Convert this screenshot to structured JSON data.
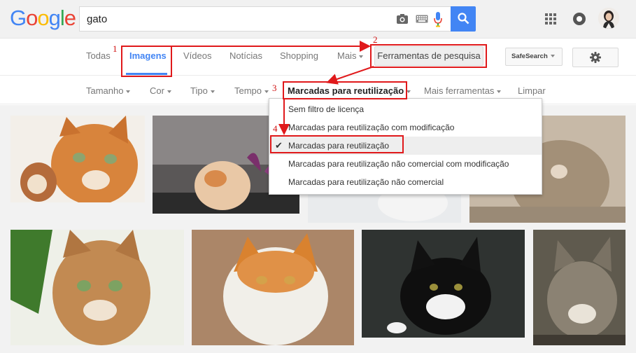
{
  "header": {
    "logo": [
      "G",
      "o",
      "o",
      "g",
      "l",
      "e"
    ],
    "logo_colors": [
      "#4285f4",
      "#ea4335",
      "#fbbc05",
      "#4285f4",
      "#34a853",
      "#ea4335"
    ],
    "search_value": "gato",
    "icons": [
      "camera-icon",
      "keyboard-icon",
      "microphone-icon",
      "search-icon",
      "apps-icon",
      "notifications-icon",
      "avatar"
    ]
  },
  "tabs": {
    "items": [
      "Todas",
      "Imagens",
      "Vídeos",
      "Notícias",
      "Shopping",
      "Mais"
    ],
    "active": "Imagens",
    "tools_label": "Ferramentas de pesquisa",
    "safesearch_label": "SafeSearch"
  },
  "filters": {
    "items": [
      "Tamanho",
      "Cor",
      "Tipo",
      "Tempo",
      "Marcadas para reutilização",
      "Mais ferramentas",
      "Limpar"
    ]
  },
  "dropdown": {
    "items": [
      "Sem filtro de licença",
      "Marcadas para reutilização com modificação",
      "Marcadas para reutilização",
      "Marcadas para reutilização não comercial com modificação",
      "Marcadas para reutilização não comercial"
    ],
    "selected_index": 2,
    "check_glyph": "✔"
  },
  "annotations": {
    "labels": [
      "1",
      "2",
      "3",
      "4"
    ],
    "color": "#e0191b"
  },
  "colors": {
    "accent": "#4285f4",
    "header_bg": "#f1f1f1"
  }
}
